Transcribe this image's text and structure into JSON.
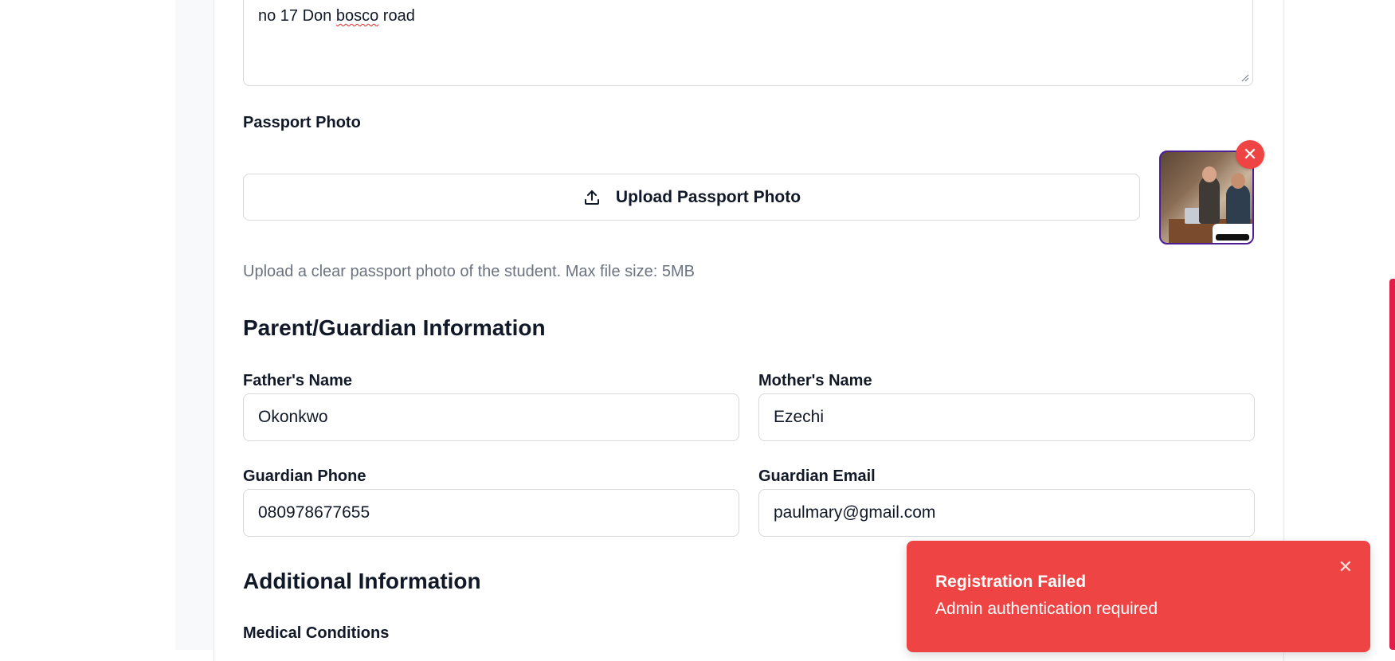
{
  "address": {
    "value_prefix": "no 17 Don ",
    "value_misspelled": "bosco",
    "value_suffix": " road"
  },
  "passport": {
    "label": "Passport Photo",
    "upload_label": "Upload Passport Photo",
    "upload_icon": "upload-icon",
    "remove_icon": "close-icon",
    "remove_symbol": "✕",
    "hint": "Upload a clear passport photo of the student. Max file size: 5MB"
  },
  "guardian_section": {
    "title": "Parent/Guardian Information",
    "father_label": "Father's Name",
    "father_value": "Okonkwo",
    "mother_label": "Mother's Name",
    "mother_value": "Ezechi",
    "phone_label": "Guardian Phone",
    "phone_value": "080978677655",
    "email_label": "Guardian Email",
    "email_value": "paulmary@gmail.com"
  },
  "additional_section": {
    "title": "Additional Information",
    "medical_label": "Medical Conditions"
  },
  "toast": {
    "title": "Registration Failed",
    "message": "Admin authentication required",
    "close_symbol": "✕",
    "color": "#ef4444"
  },
  "colors": {
    "accent_red": "#ef4444",
    "scrollbar": "#e11d48",
    "text": "#111827",
    "muted": "#6b7280",
    "border": "#d6d9de"
  }
}
